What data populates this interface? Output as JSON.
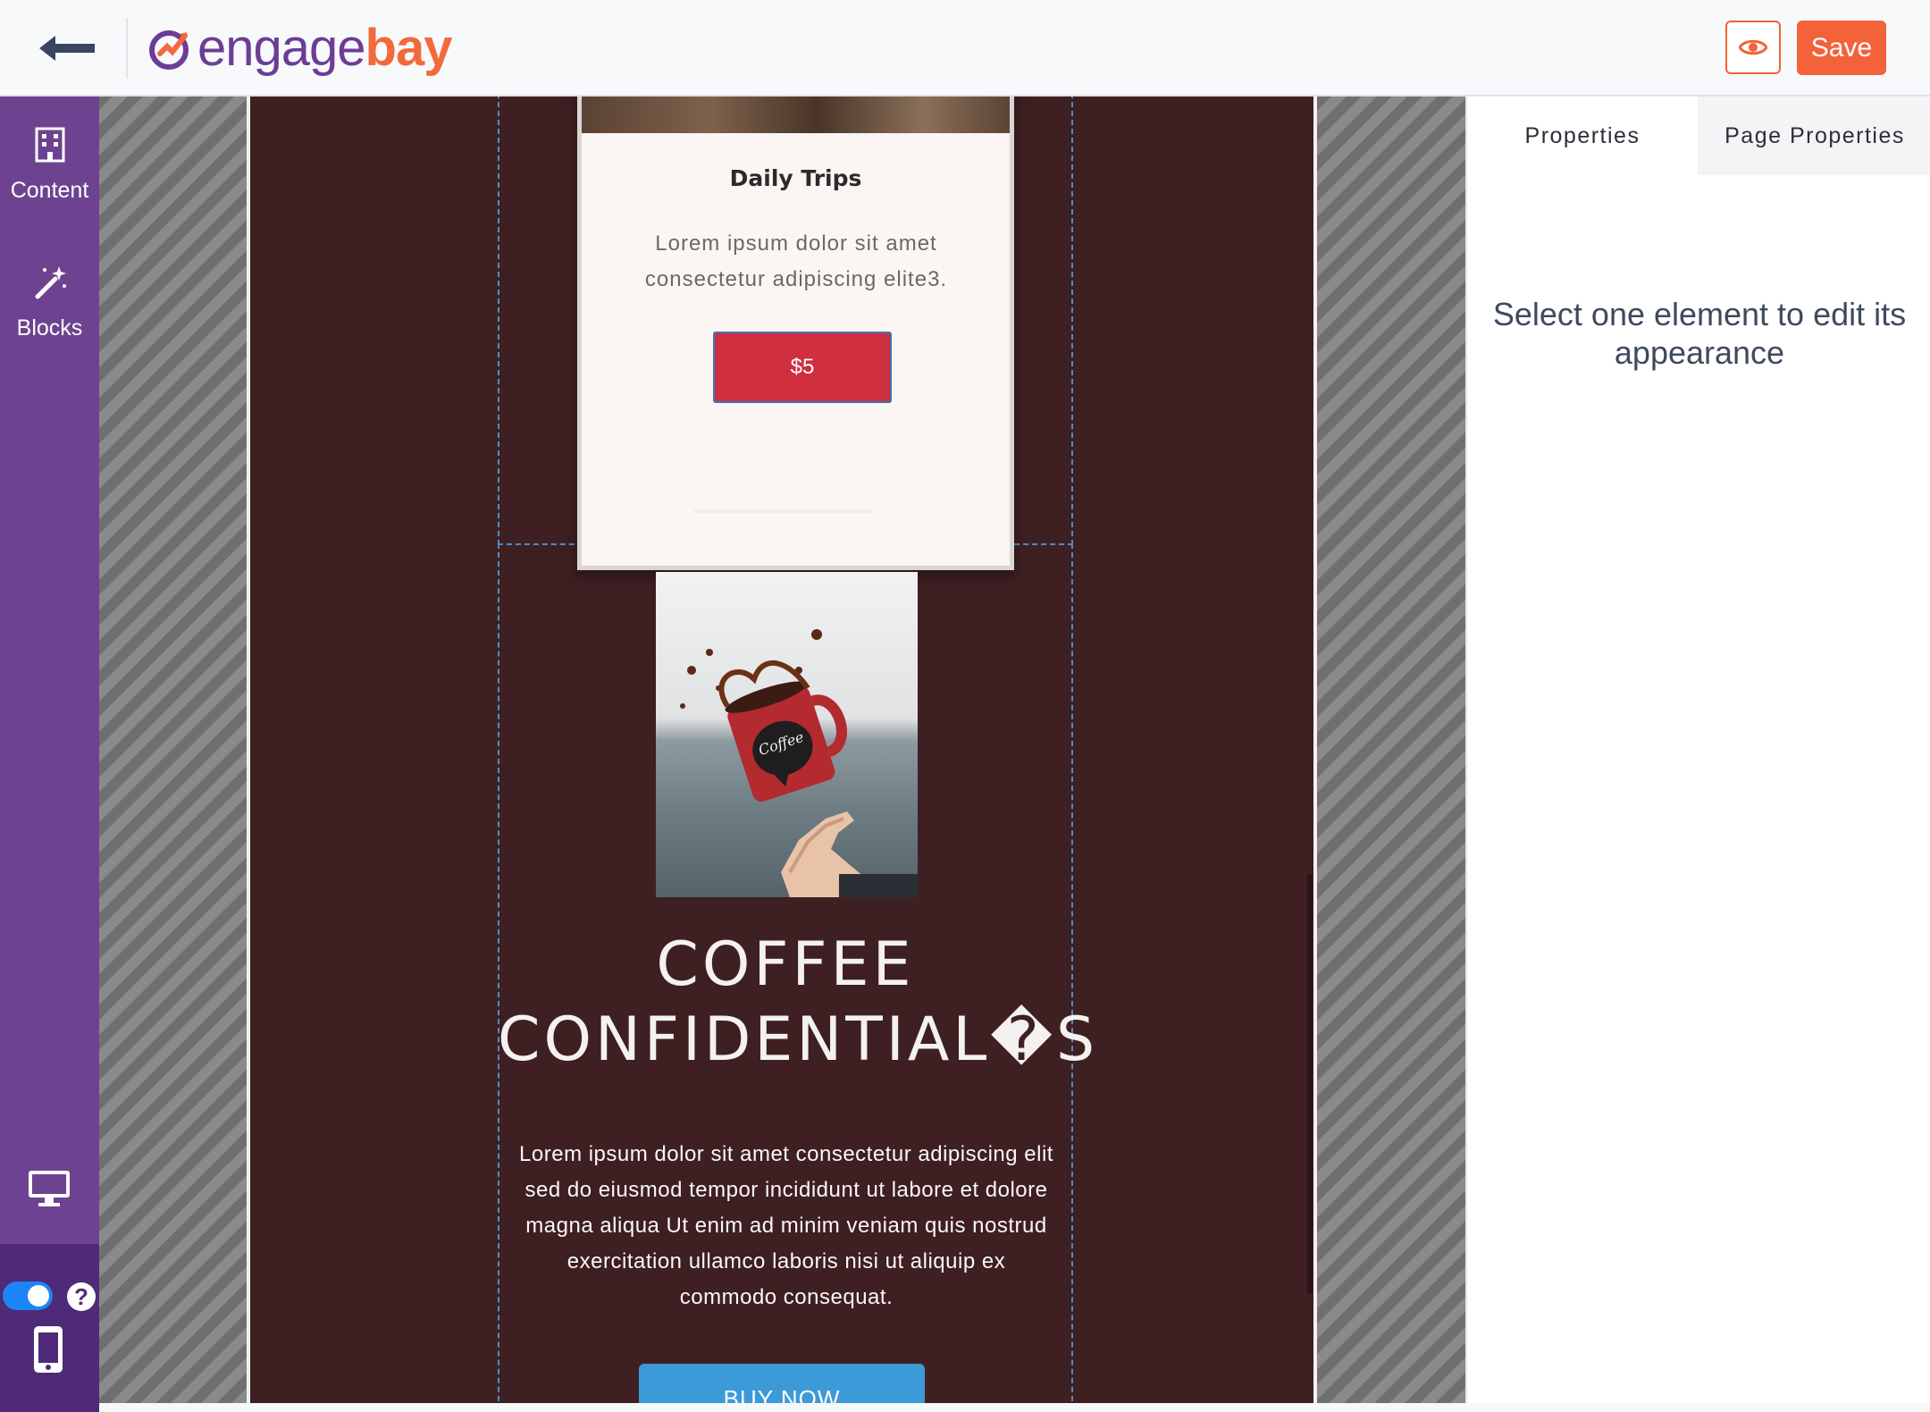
{
  "header": {
    "back_label": "Back",
    "logo_part1": "engage",
    "logo_part2": "bay",
    "preview_icon": "eye-icon",
    "save_label": "Save"
  },
  "sidebar": {
    "items": [
      {
        "label": "Content",
        "icon": "building-icon"
      },
      {
        "label": "Blocks",
        "icon": "magic-wand-icon"
      }
    ],
    "bottom": {
      "desktop_icon": "desktop-icon",
      "toggle_on": true,
      "help_label": "?",
      "mobile_icon": "mobile-icon"
    }
  },
  "canvas": {
    "card": {
      "title": "Daily Trips",
      "text": "Lorem ipsum dolor sit amet consectetur adipiscing elite3.",
      "price_label": "$5"
    },
    "hero": {
      "heading": "COFFEE CONFIDENTIAL�S",
      "body": "Lorem ipsum dolor sit amet consectetur adipiscing elit sed do eiusmod tempor incididunt ut labore et dolore magna aliqua Ut enim ad minim veniam quis nostrud exercitation ullamco laboris nisi ut aliquip ex commodo consequat.",
      "button_label": "BUY NOW"
    }
  },
  "right_panel": {
    "tabs": [
      "Properties",
      "Page Properties"
    ],
    "hint": "Select one element to edit its appearance"
  },
  "colors": {
    "brand_purple": "#6d4391",
    "brand_orange": "#f4623a",
    "page_bg": "#3e1f22",
    "card_button": "#cf2f3f",
    "buy_button": "#3d9ad8"
  }
}
